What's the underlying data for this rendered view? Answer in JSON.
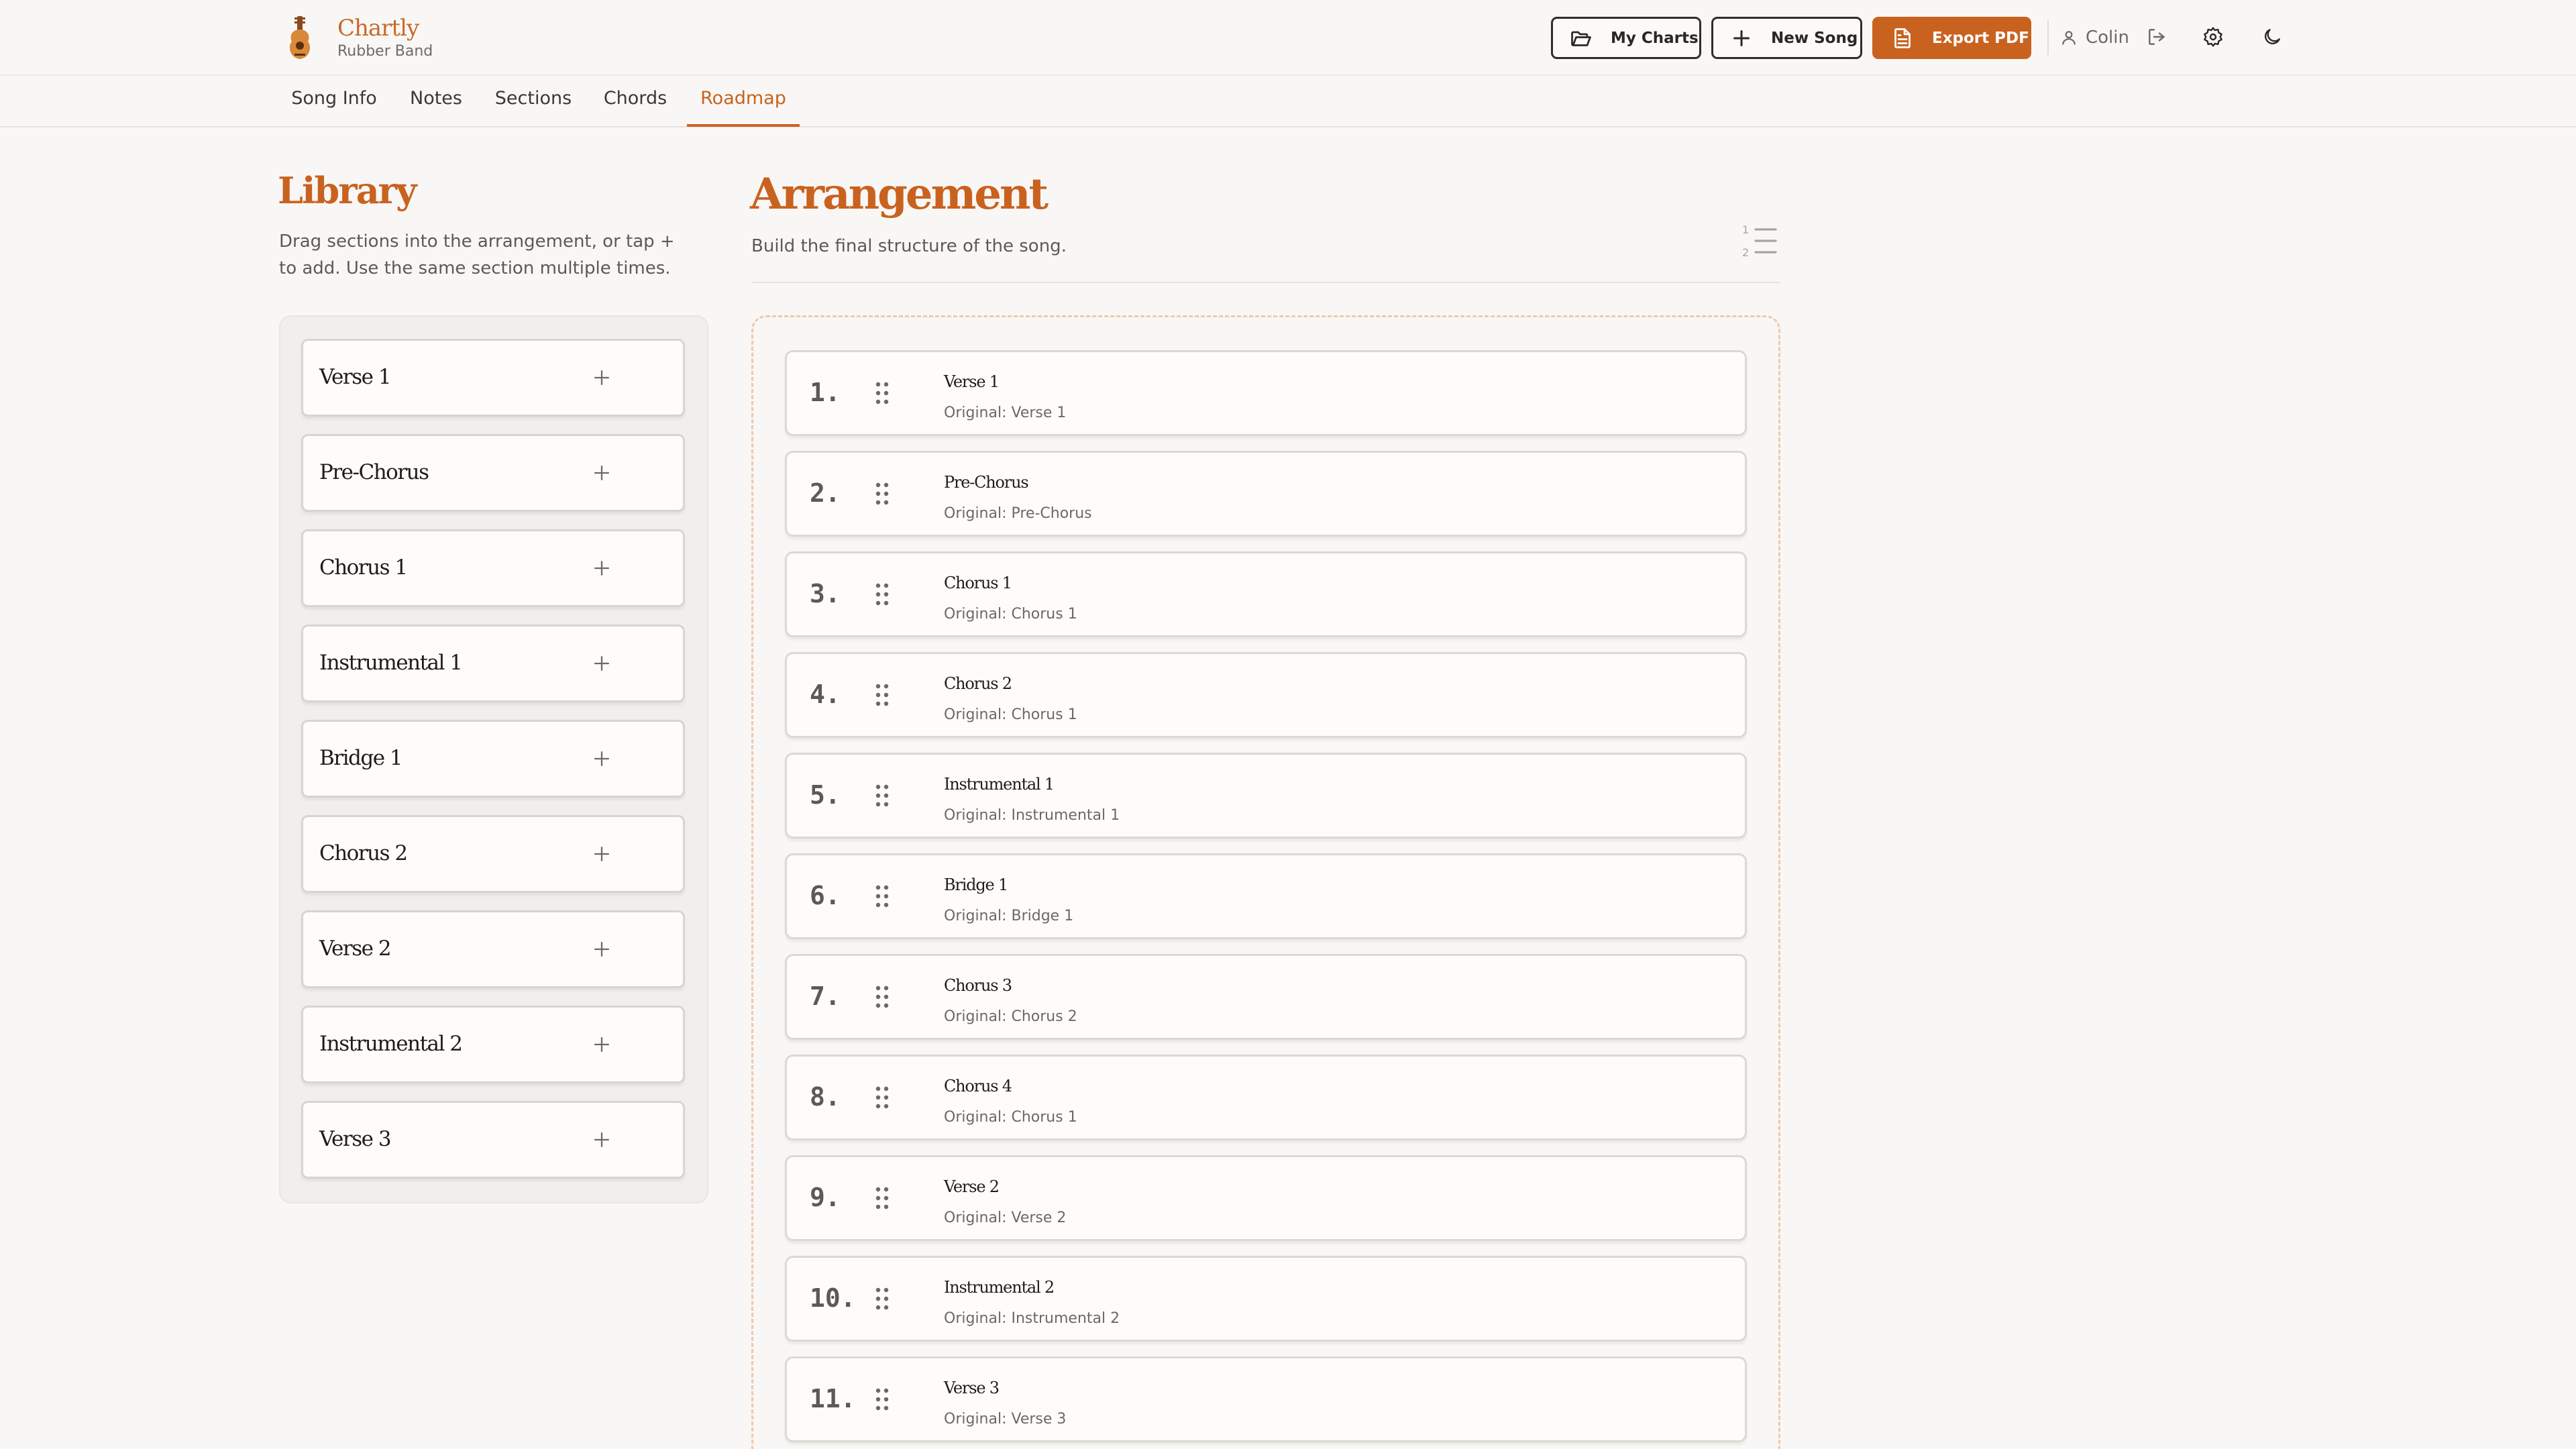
{
  "app": {
    "title": "Chartly",
    "subtitle": "Rubber Band",
    "logo_icon": "guitar-icon",
    "accent": "#c9621f"
  },
  "header": {
    "my_charts": "My Charts",
    "new_song": "New Song",
    "export_pdf": "Export PDF",
    "user": "Colin",
    "icons": [
      "folder-open-icon",
      "plus-icon",
      "file-text-icon",
      "user-icon",
      "logout-icon",
      "gear-icon",
      "moon-icon"
    ]
  },
  "tabs": [
    {
      "label": "Song Info",
      "active": false
    },
    {
      "label": "Notes",
      "active": false
    },
    {
      "label": "Sections",
      "active": false
    },
    {
      "label": "Chords",
      "active": false
    },
    {
      "label": "Roadmap",
      "active": true
    }
  ],
  "library": {
    "title": "Library",
    "description": "Drag sections into the arrangement, or tap + to add. Use the same section multiple times.",
    "items": [
      {
        "label": "Verse 1"
      },
      {
        "label": "Pre-Chorus"
      },
      {
        "label": "Chorus 1"
      },
      {
        "label": "Instrumental 1"
      },
      {
        "label": "Bridge 1"
      },
      {
        "label": "Chorus 2"
      },
      {
        "label": "Verse 2"
      },
      {
        "label": "Instrumental 2"
      },
      {
        "label": "Verse 3"
      }
    ]
  },
  "arrangement": {
    "title": "Arrangement",
    "description": "Build the final structure of the song.",
    "items": [
      {
        "number": "1.",
        "name": "Verse 1",
        "original": "Original: Verse 1"
      },
      {
        "number": "2.",
        "name": "Pre-Chorus",
        "original": "Original: Pre-Chorus"
      },
      {
        "number": "3.",
        "name": "Chorus 1",
        "original": "Original: Chorus 1"
      },
      {
        "number": "4.",
        "name": "Chorus 2",
        "original": "Original: Chorus 1"
      },
      {
        "number": "5.",
        "name": "Instrumental 1",
        "original": "Original: Instrumental 1"
      },
      {
        "number": "6.",
        "name": "Bridge 1",
        "original": "Original: Bridge 1"
      },
      {
        "number": "7.",
        "name": "Chorus 3",
        "original": "Original: Chorus 2"
      },
      {
        "number": "8.",
        "name": "Chorus 4",
        "original": "Original: Chorus 1"
      },
      {
        "number": "9.",
        "name": "Verse 2",
        "original": "Original: Verse 2"
      },
      {
        "number": "10.",
        "name": "Instrumental 2",
        "original": "Original: Instrumental 2"
      },
      {
        "number": "11.",
        "name": "Verse 3",
        "original": "Original: Verse 3"
      }
    ]
  }
}
